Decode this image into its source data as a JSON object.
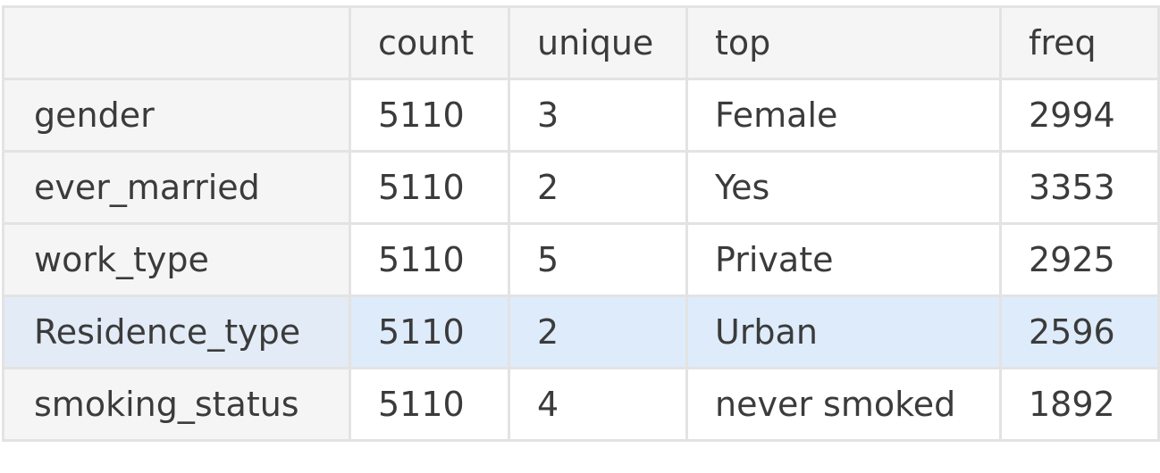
{
  "table": {
    "columns": [
      "",
      "count",
      "unique",
      "top",
      "freq"
    ],
    "rows": [
      {
        "label": "gender",
        "count": "5110",
        "unique": "3",
        "top": "Female",
        "freq": "2994"
      },
      {
        "label": "ever_married",
        "count": "5110",
        "unique": "2",
        "top": "Yes",
        "freq": "3353"
      },
      {
        "label": "work_type",
        "count": "5110",
        "unique": "5",
        "top": "Private",
        "freq": "2925"
      },
      {
        "label": "Residence_type",
        "count": "5110",
        "unique": "2",
        "top": "Urban",
        "freq": "2596",
        "selected": true
      },
      {
        "label": "smoking_status",
        "count": "5110",
        "unique": "4",
        "top": "never smoked",
        "freq": "1892"
      }
    ]
  },
  "colors": {
    "header_bg": "#f5f5f5",
    "border": "#e3e3e3",
    "selected_row_bg": "#deebfb",
    "text": "#3b3b3b"
  }
}
